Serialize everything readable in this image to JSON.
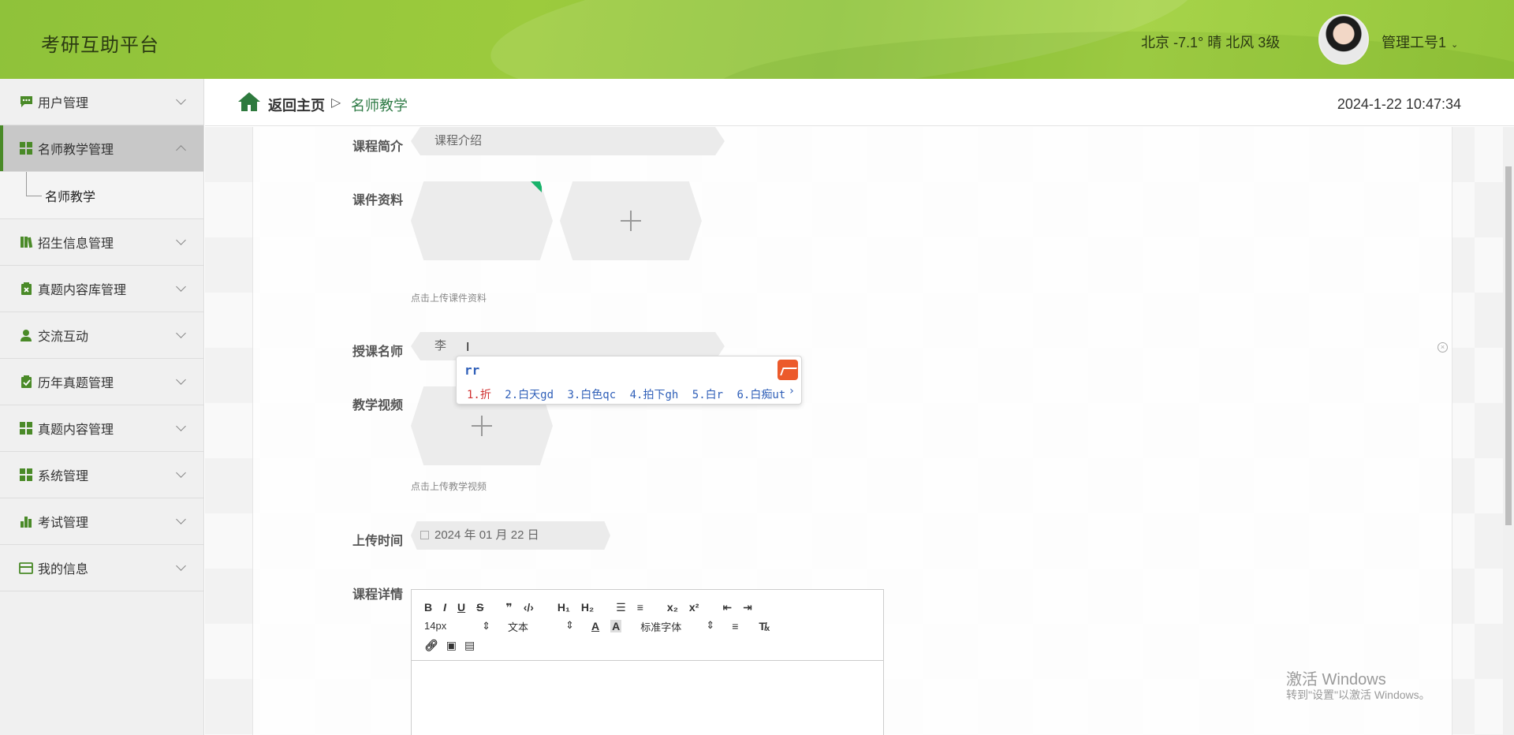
{
  "header": {
    "title": "考研互助平台",
    "weather": "北京  -7.1°  晴  北风  3级",
    "user": "管理工号1"
  },
  "sidebar": {
    "items": [
      {
        "label": "用户管理",
        "icon": "chat-icon"
      },
      {
        "label": "名师教学管理",
        "icon": "grid-icon",
        "open": true,
        "children": [
          "名师教学"
        ]
      },
      {
        "label": "招生信息管理",
        "icon": "books-icon"
      },
      {
        "label": "真题内容库管理",
        "icon": "clipboard-x-icon"
      },
      {
        "label": "交流互动",
        "icon": "user-icon"
      },
      {
        "label": "历年真题管理",
        "icon": "clipboard-check-icon"
      },
      {
        "label": "真题内容管理",
        "icon": "grid-icon"
      },
      {
        "label": "系统管理",
        "icon": "grid-icon"
      },
      {
        "label": "考试管理",
        "icon": "bar-chart-icon"
      },
      {
        "label": "我的信息",
        "icon": "card-icon"
      }
    ]
  },
  "breadcrumb": {
    "home": "返回主页",
    "separator": "▷",
    "current": "名师教学",
    "datetime": "2024-1-22 10:47:34"
  },
  "form": {
    "course_intro_label": "课程简介",
    "course_intro_value": "课程介绍",
    "materials_label": "课件资料",
    "materials_hint": "点击上传课件资料",
    "teacher_label": "授课名师",
    "teacher_value": "李",
    "video_label": "教学视频",
    "video_hint": "点击上传教学视频",
    "upload_time_label": "上传时间",
    "upload_time_value": "2024 年 01 月 22 日",
    "detail_label": "课程详情"
  },
  "ime": {
    "code": "rr",
    "candidates": [
      "1.折",
      "2.白天gd",
      "3.白色qc",
      "4.拍下gh",
      "5.白r",
      "6.白痴ut"
    ],
    "next": "›"
  },
  "editor": {
    "font_size": "14px",
    "paragraph": "文本",
    "font_family": "标准字体"
  },
  "watermark": {
    "line1": "激活 Windows",
    "line2": "转到\"设置\"以激活 Windows。"
  },
  "colors": {
    "header_green": "#9ccb3d",
    "accent_green": "#4a8a28",
    "breadcrumb_current": "#2f7b46"
  }
}
